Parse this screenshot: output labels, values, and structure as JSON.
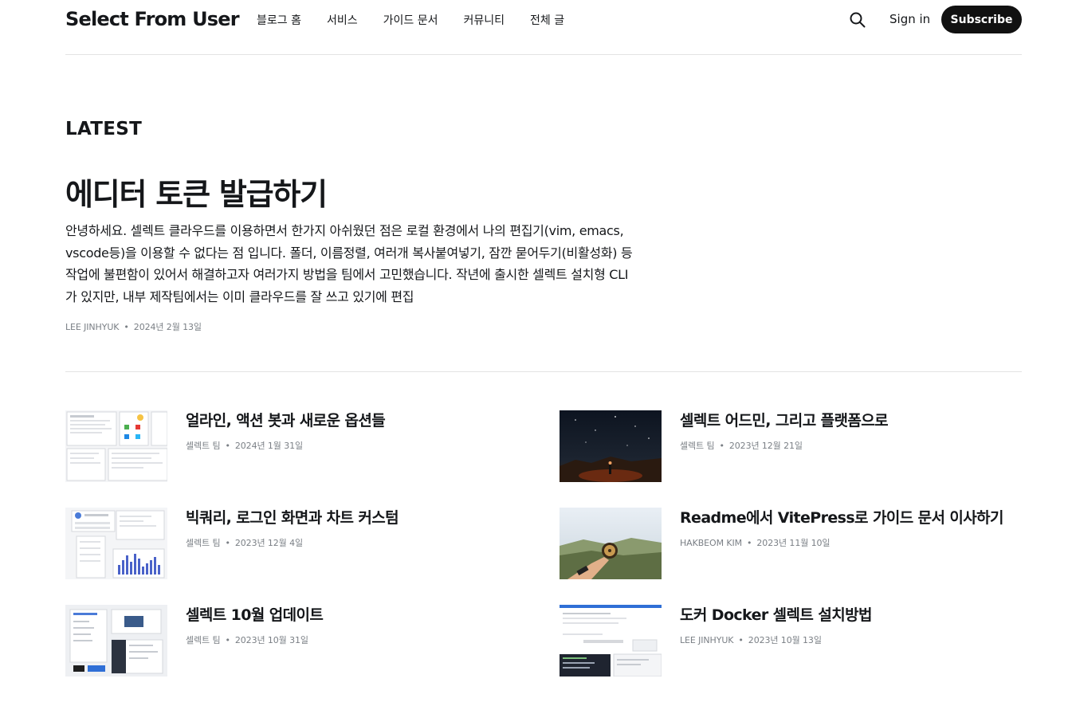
{
  "header": {
    "logo": "Select From User",
    "nav": [
      "블로그 홈",
      "서비스",
      "가이드 문서",
      "커뮤니티",
      "전체 글"
    ],
    "search_icon": "search-icon",
    "signin": "Sign in",
    "subscribe": "Subscribe"
  },
  "latest": {
    "label": "LATEST",
    "title": "에디터 토큰 발급하기",
    "excerpt": "안녕하세요. 셀렉트 클라우드를 이용하면서 한가지 아쉬웠던 점은 로컬 환경에서 나의 편집기(vim, emacs, vscode등)을 이용할 수 없다는 점 입니다. 폴더, 이름정렬, 여러개 복사붙여넣기, 잠깐 묻어두기(비활성화) 등 작업에 불편함이 있어서 해결하고자 여러가지 방법을 팀에서 고민했습니다. 작년에 출시한 셀렉트 설치형 CLI가 있지만, 내부 제작팀에서는 이미 클라우드를 잘 쓰고 있기에 편집",
    "author": "LEE JINHYUK",
    "date": "2024년 2월 13일"
  },
  "posts": [
    {
      "title": "얼라인, 액션 봇과 새로운 옵션들",
      "author": "셀렉트 팀",
      "date": "2024년 1월 31일"
    },
    {
      "title": "셀렉트 어드민, 그리고 플랫폼으로",
      "author": "셀렉트 팀",
      "date": "2023년 12월 21일"
    },
    {
      "title": "빅쿼리, 로그인 화면과 차트 커스텀",
      "author": "셀렉트 팀",
      "date": "2023년 12월 4일"
    },
    {
      "title": "Readme에서 VitePress로 가이드 문서 이사하기",
      "author": "HAKBEOM KIM",
      "date": "2023년 11월 10일"
    },
    {
      "title": "셀렉트 10월 업데이트",
      "author": "셀렉트 팀",
      "date": "2023년 10월 31일"
    },
    {
      "title": "도커 Docker 셀렉트 설치방법",
      "author": "LEE JINHYUK",
      "date": "2023년 10월 13일"
    }
  ],
  "colors": {
    "accent": "#111111",
    "text": "#15171a",
    "meta": "#7a7f85",
    "divider": "#e3e3e3"
  }
}
